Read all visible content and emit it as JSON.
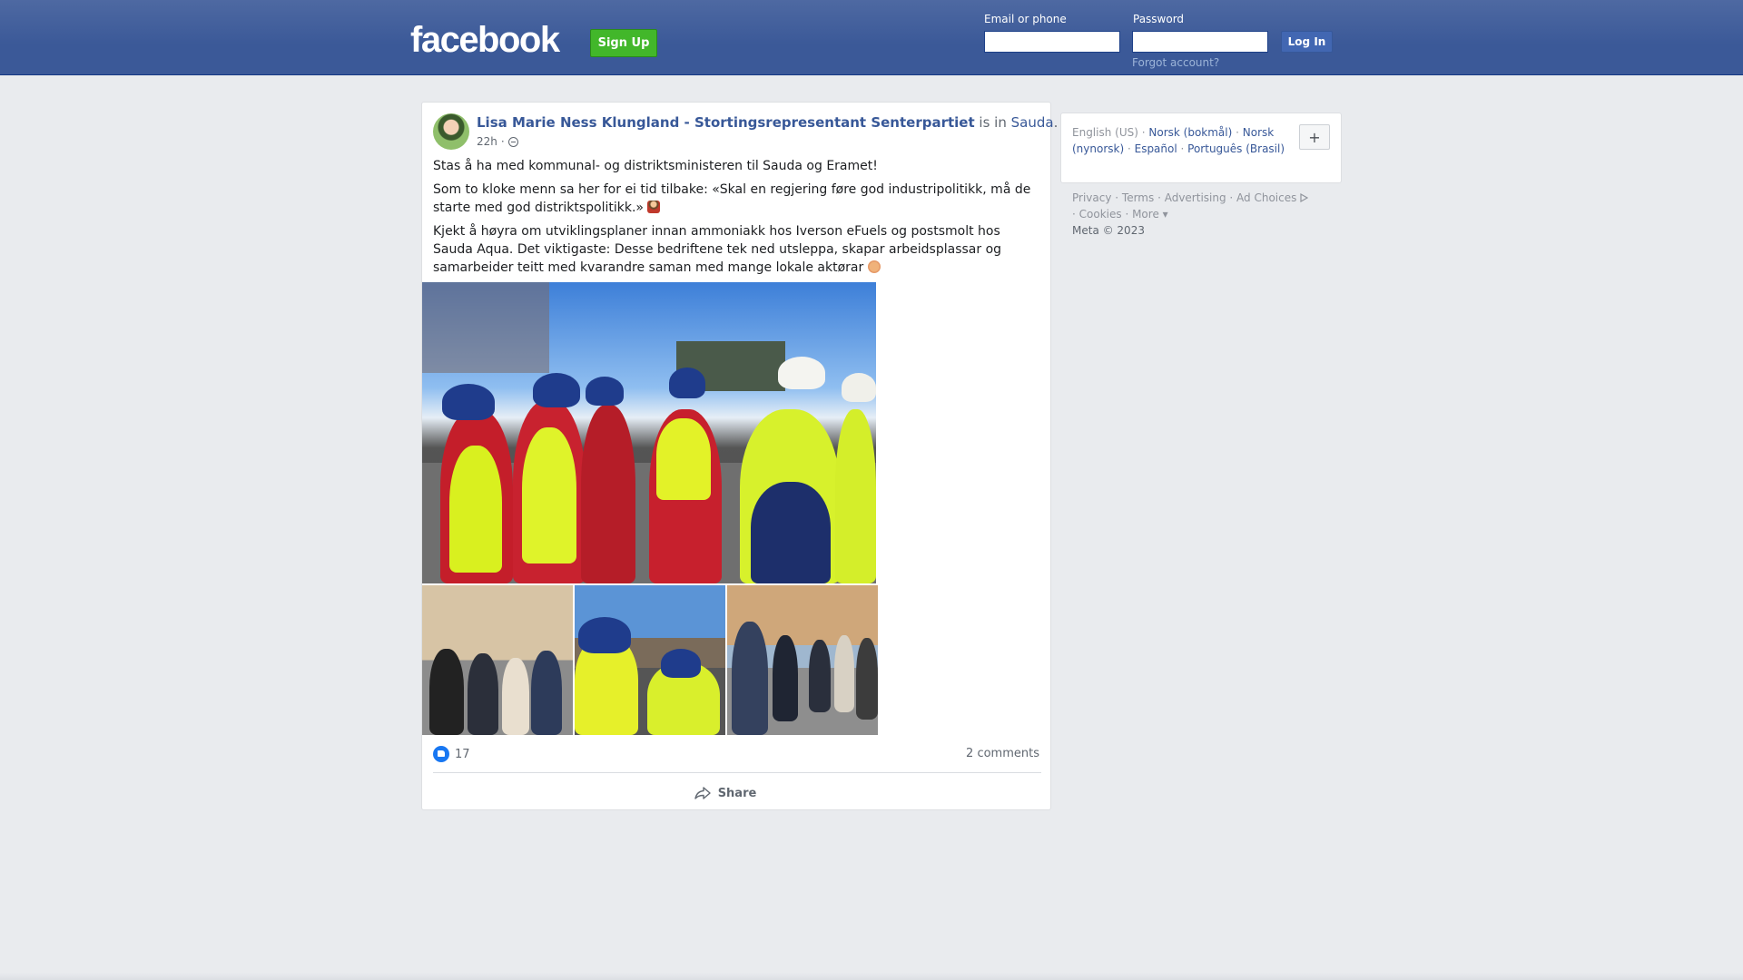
{
  "header": {
    "logo": "facebook",
    "signup_label": "Sign Up",
    "email_label": "Email or phone",
    "email_value": "",
    "password_label": "Password",
    "password_value": "",
    "login_label": "Log In",
    "forgot_label": "Forgot account?"
  },
  "post": {
    "author": "Lisa Marie Ness Klungland - Stortingsrepresentant Senterpartiet",
    "is_in": "is in",
    "place": "Sauda",
    "period": ".",
    "time": "22h",
    "dot": "·",
    "privacy_icon": "globe-icon",
    "paragraphs": [
      "Stas å ha med kommunal- og distriktsministeren til Sauda og Eramet!",
      "Som to kloke menn sa her for ei tid tilbake: «Skal en regjering føre god industripolitikk, må de starte med god distriktspolitikk.»",
      "Kjekt å høyra om utviklingsplaner innan ammoniakk hos Iverson eFuels og postsmolt hos Sauda Aqua. Det viktigaste: Desse bedriftene tek ned utsleppa, skapar arbeidsplassar og samarbeider teitt med kvarandre saman med mange lokale aktørar"
    ],
    "reaction_count": "17",
    "comments": "2 comments",
    "share_label": "Share"
  },
  "languages": {
    "current": "English (US)",
    "items": [
      "Norsk (bokmål)",
      "Norsk (nynorsk)",
      "Español",
      "Português (Brasil)"
    ],
    "add_label": "+"
  },
  "footer": {
    "links": [
      "Privacy",
      "Terms",
      "Advertising",
      "Ad Choices",
      "Cookies",
      "More"
    ],
    "copyright": "Meta © 2023"
  },
  "colors": {
    "topbar": "#3b5998",
    "signup": "#42b72a",
    "link": "#385898",
    "like": "#1877f2"
  }
}
